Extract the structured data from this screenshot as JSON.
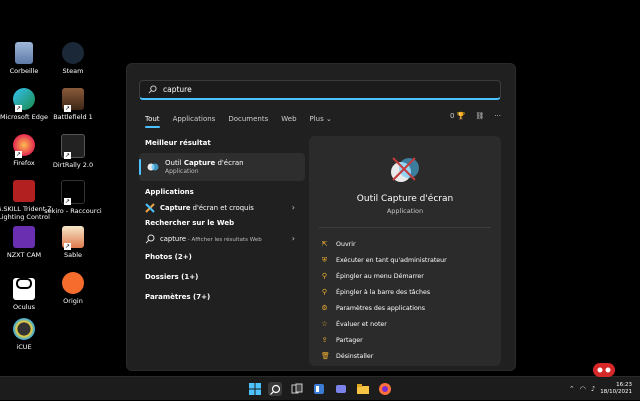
{
  "desktop": {
    "icons": [
      {
        "label": "Corbeille"
      },
      {
        "label": "Steam"
      },
      {
        "label": "Microsoft Edge"
      },
      {
        "label": "Battlefield 1"
      },
      {
        "label": "Firefox"
      },
      {
        "label": "DirtRally 2.0"
      },
      {
        "label": "G.SKILL Trident Z Lighting Control"
      },
      {
        "label": "sekiro - Raccourci"
      },
      {
        "label": "NZXT CAM"
      },
      {
        "label": "Sable"
      },
      {
        "label": "Oculus"
      },
      {
        "label": "Origin"
      },
      {
        "label": "iCUE"
      }
    ]
  },
  "search": {
    "value": "capture",
    "placeholder": ""
  },
  "filters": {
    "tabs": [
      "Tout",
      "Applications",
      "Documents",
      "Web",
      "Plus"
    ],
    "active": "Tout",
    "points": "0"
  },
  "results": {
    "best_title": "Meilleur résultat",
    "best": {
      "name_prefix": "Outil ",
      "name_bold": "Capture",
      "name_suffix": " d'écran",
      "type": "Application"
    },
    "apps_title": "Applications",
    "apps": [
      {
        "name_bold": "Capture",
        "name_rest": " d'écran et croquis"
      }
    ],
    "web_title": "Rechercher sur le Web",
    "web": {
      "query": "capture",
      "hint": " - Afficher les résultats Web"
    },
    "photos": "Photos (2+)",
    "folders": "Dossiers (1+)",
    "settings": "Paramètres (7+)"
  },
  "detail": {
    "title": "Outil Capture d'écran",
    "subtitle": "Application",
    "actions": [
      {
        "label": "Ouvrir",
        "icon": "open-icon"
      },
      {
        "label": "Exécuter en tant qu'administrateur",
        "icon": "shield-icon"
      },
      {
        "label": "Épingler au menu Démarrer",
        "icon": "pin-icon"
      },
      {
        "label": "Épingler à la barre des tâches",
        "icon": "pin-icon"
      },
      {
        "label": "Paramètres des applications",
        "icon": "gear-icon"
      },
      {
        "label": "Évaluer et noter",
        "icon": "star-icon"
      },
      {
        "label": "Partager",
        "icon": "share-icon"
      },
      {
        "label": "Désinstaller",
        "icon": "trash-icon"
      }
    ]
  },
  "taskbar": {
    "time": "16:23",
    "date": "18/10/2021"
  },
  "colors": {
    "accent": "#4cc2ff",
    "action_icon": "#f0b030"
  }
}
